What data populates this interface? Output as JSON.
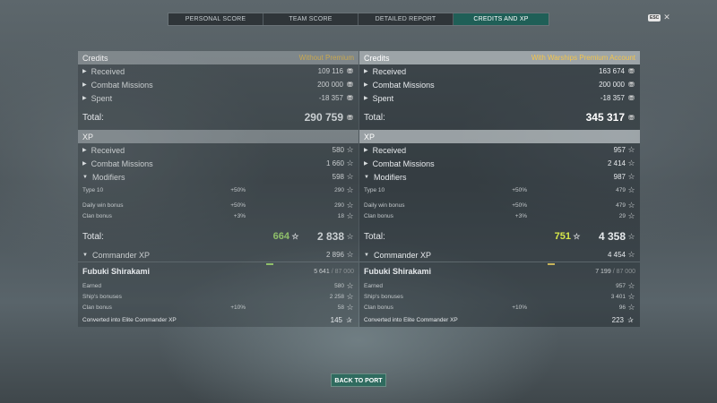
{
  "tabs": [
    {
      "label": "PERSONAL SCORE"
    },
    {
      "label": "TEAM SCORE"
    },
    {
      "label": "DETAILED REPORT"
    },
    {
      "label": "CREDITS AND XP",
      "active": true
    }
  ],
  "esc_label": "ESC",
  "icons": {
    "close": "close-icon",
    "credit": "credit-icon",
    "xp": "star-icon",
    "elite": "elite-xp-icon"
  },
  "left": {
    "credits_header": "Credits",
    "account": "Without Premium",
    "received": {
      "label": "Received",
      "value": "109 116"
    },
    "combat_missions": {
      "label": "Combat Missions",
      "value": "200 000"
    },
    "spent": {
      "label": "Spent",
      "value": "-18 357"
    },
    "credits_total": {
      "label": "Total:",
      "value": "290 759"
    },
    "xp_header": "XP",
    "xp_received": {
      "label": "Received",
      "value": "580"
    },
    "xp_combat_missions": {
      "label": "Combat Missions",
      "value": "1 660"
    },
    "modifiers": {
      "label": "Modifiers",
      "value": "598"
    },
    "type10": {
      "label": "Type 10",
      "pct": "+50%",
      "value": "290"
    },
    "daily_win": {
      "label": "Daily win bonus",
      "pct": "+50%",
      "value": "290"
    },
    "clan_bonus": {
      "label": "Clan bonus",
      "pct": "+3%",
      "value": "18"
    },
    "xp_total": {
      "label": "Total:",
      "base": "664",
      "value": "2 838"
    },
    "commander_xp": {
      "label": "Commander XP",
      "value": "2 896"
    },
    "commander": {
      "name": "Fubuki Shirakami",
      "current": "5 641",
      "max": "/ 87 000"
    },
    "earned": {
      "label": "Earned",
      "value": "580"
    },
    "ships_bonuses": {
      "label": "Ship's bonuses",
      "value": "2 258"
    },
    "cmd_clan_bonus": {
      "label": "Clan bonus",
      "pct": "+10%",
      "value": "58"
    },
    "converted": {
      "label": "Converted into Elite Commander XP",
      "value": "145"
    }
  },
  "right": {
    "credits_header": "Credits",
    "account": "With Warships Premium Account",
    "received": {
      "label": "Received",
      "value": "163 674"
    },
    "combat_missions": {
      "label": "Combat Missions",
      "value": "200 000"
    },
    "spent": {
      "label": "Spent",
      "value": "-18 357"
    },
    "credits_total": {
      "label": "Total:",
      "value": "345 317"
    },
    "xp_header": "XP",
    "xp_received": {
      "label": "Received",
      "value": "957"
    },
    "xp_combat_missions": {
      "label": "Combat Missions",
      "value": "2 414"
    },
    "modifiers": {
      "label": "Modifiers",
      "value": "987"
    },
    "type10": {
      "label": "Type 10",
      "pct": "+50%",
      "value": "479"
    },
    "daily_win": {
      "label": "Daily win bonus",
      "pct": "+50%",
      "value": "479"
    },
    "clan_bonus": {
      "label": "Clan bonus",
      "pct": "+3%",
      "value": "29"
    },
    "xp_total": {
      "label": "Total:",
      "base": "751",
      "value": "4 358"
    },
    "commander_xp": {
      "label": "Commander XP",
      "value": "4 454"
    },
    "commander": {
      "name": "Fubuki Shirakami",
      "current": "7 199",
      "max": "/ 87 000"
    },
    "earned": {
      "label": "Earned",
      "value": "957"
    },
    "ships_bonuses": {
      "label": "Ship's bonuses",
      "value": "3 401"
    },
    "cmd_clan_bonus": {
      "label": "Clan bonus",
      "pct": "+10%",
      "value": "96"
    },
    "converted": {
      "label": "Converted into Elite Commander XP",
      "value": "223"
    }
  },
  "back_button": "BACK TO PORT"
}
